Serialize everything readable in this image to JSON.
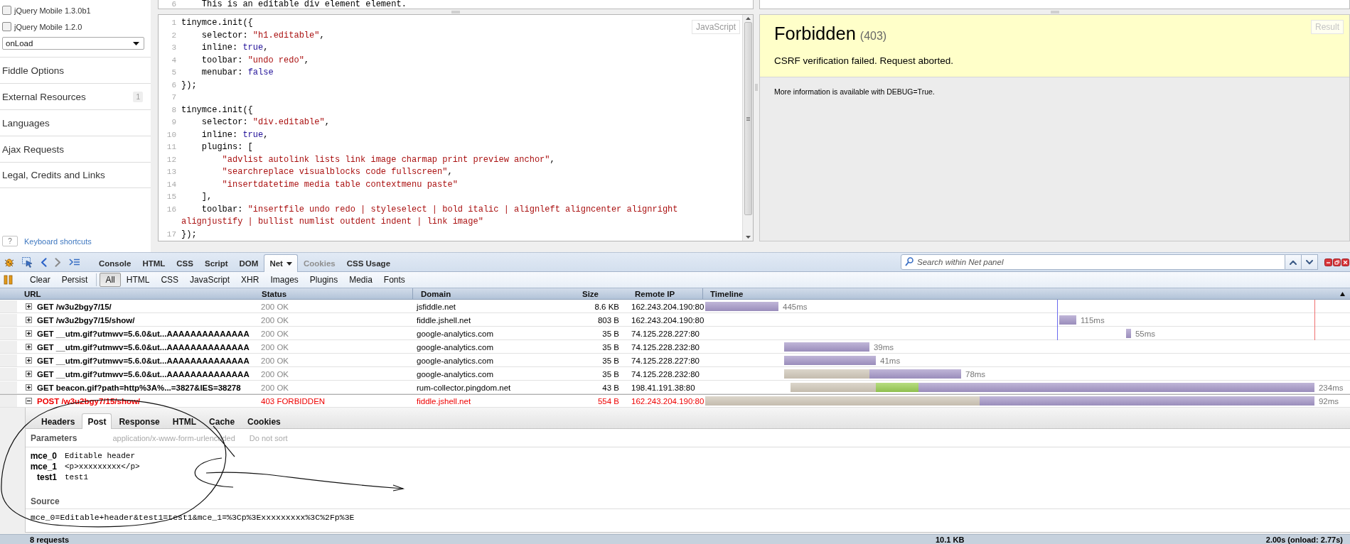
{
  "sidebar": {
    "libraries": [
      {
        "label": "jQuery Mobile 1.3.0b1",
        "checked": false
      },
      {
        "label": "jQuery Mobile 1.2.0",
        "checked": false
      }
    ],
    "load_select": {
      "value": "onLoad"
    },
    "sections": [
      {
        "label": "Fiddle Options"
      },
      {
        "label": "External Resources",
        "badge": "1"
      },
      {
        "label": "Languages"
      },
      {
        "label": "Ajax Requests"
      },
      {
        "label": "Legal, Credits and Links"
      }
    ],
    "shortcuts": {
      "key": "?",
      "link": "Keyboard shortcuts"
    }
  },
  "html_panel": {
    "lines": [
      {
        "number": "6",
        "text": "    This is an editable div element element."
      }
    ]
  },
  "js_panel": {
    "label": "JavaScript",
    "lines": [
      {
        "number": "1",
        "tokens": [
          {
            "kind": "plain",
            "text": "tinymce.init({"
          }
        ]
      },
      {
        "number": "2",
        "tokens": [
          {
            "kind": "plain",
            "text": "    selector: "
          },
          {
            "kind": "string",
            "text": "\"h1.editable\""
          },
          {
            "kind": "plain",
            "text": ","
          }
        ]
      },
      {
        "number": "3",
        "tokens": [
          {
            "kind": "plain",
            "text": "    inline: "
          },
          {
            "kind": "atom",
            "text": "true"
          },
          {
            "kind": "plain",
            "text": ","
          }
        ]
      },
      {
        "number": "4",
        "tokens": [
          {
            "kind": "plain",
            "text": "    toolbar: "
          },
          {
            "kind": "string",
            "text": "\"undo redo\""
          },
          {
            "kind": "plain",
            "text": ","
          }
        ]
      },
      {
        "number": "5",
        "tokens": [
          {
            "kind": "plain",
            "text": "    menubar: "
          },
          {
            "kind": "atom",
            "text": "false"
          }
        ]
      },
      {
        "number": "6",
        "tokens": [
          {
            "kind": "plain",
            "text": "});"
          }
        ]
      },
      {
        "number": "7"
      },
      {
        "number": "8",
        "tokens": [
          {
            "kind": "plain",
            "text": "tinymce.init({"
          }
        ]
      },
      {
        "number": "9",
        "tokens": [
          {
            "kind": "plain",
            "text": "    selector: "
          },
          {
            "kind": "string",
            "text": "\"div.editable\""
          },
          {
            "kind": "plain",
            "text": ","
          }
        ]
      },
      {
        "number": "10",
        "tokens": [
          {
            "kind": "plain",
            "text": "    inline: "
          },
          {
            "kind": "atom",
            "text": "true"
          },
          {
            "kind": "plain",
            "text": ","
          }
        ]
      },
      {
        "number": "11",
        "tokens": [
          {
            "kind": "plain",
            "text": "    plugins: ["
          }
        ]
      },
      {
        "number": "12",
        "tokens": [
          {
            "kind": "string",
            "text": "        \"advlist autolink lists link image charmap print preview anchor\""
          },
          {
            "kind": "plain",
            "text": ","
          }
        ]
      },
      {
        "number": "13",
        "tokens": [
          {
            "kind": "string",
            "text": "        \"searchreplace visualblocks code fullscreen\""
          },
          {
            "kind": "plain",
            "text": ","
          }
        ]
      },
      {
        "number": "14",
        "tokens": [
          {
            "kind": "string",
            "text": "        \"insertdatetime media table contextmenu paste\""
          }
        ]
      },
      {
        "number": "15",
        "tokens": [
          {
            "kind": "plain",
            "text": "    ],"
          }
        ]
      },
      {
        "number": "16",
        "tokens": [
          {
            "kind": "plain",
            "text": "    toolbar: "
          },
          {
            "kind": "string",
            "text": "\"insertfile undo redo | styleselect | bold italic | alignleft aligncenter alignright alignjustify | bullist numlist outdent indent | link image\""
          }
        ]
      },
      {
        "number": "17",
        "tokens": [
          {
            "kind": "plain",
            "text": "});"
          }
        ]
      }
    ]
  },
  "result_panel": {
    "label": "Result",
    "title": "Forbidden",
    "code": "(403)",
    "message": "CSRF verification failed. Request aborted.",
    "info": "More information is available with DEBUG=True."
  },
  "firebug": {
    "panel_tabs": [
      {
        "label": "Console",
        "selected": false,
        "disabled": false,
        "dropdown": false
      },
      {
        "label": "HTML",
        "selected": false,
        "disabled": false,
        "dropdown": false
      },
      {
        "label": "CSS",
        "selected": false,
        "disabled": false,
        "dropdown": false
      },
      {
        "label": "Script",
        "selected": false,
        "disabled": false,
        "dropdown": false
      },
      {
        "label": "DOM",
        "selected": false,
        "disabled": false,
        "dropdown": false
      },
      {
        "label": "Net",
        "selected": true,
        "disabled": false,
        "dropdown": true
      },
      {
        "label": "Cookies",
        "selected": false,
        "disabled": true,
        "dropdown": false
      },
      {
        "label": "CSS Usage",
        "selected": false,
        "disabled": false,
        "dropdown": false
      }
    ],
    "search": {
      "placeholder": "Search within Net panel"
    },
    "actions": [
      "Clear",
      "Persist"
    ],
    "filters": [
      {
        "label": "All",
        "selected": true
      },
      {
        "label": "HTML",
        "selected": false
      },
      {
        "label": "CSS",
        "selected": false
      },
      {
        "label": "JavaScript",
        "selected": false
      },
      {
        "label": "XHR",
        "selected": false
      },
      {
        "label": "Images",
        "selected": false
      },
      {
        "label": "Plugins",
        "selected": false
      },
      {
        "label": "Media",
        "selected": false
      },
      {
        "label": "Fonts",
        "selected": false
      }
    ],
    "net_table": {
      "columns": [
        "URL",
        "Status",
        "Domain",
        "Size",
        "Remote IP",
        "Timeline"
      ],
      "rows": [
        {
          "url": "GET /w3u2bgy7/15/",
          "status": "200 OK",
          "domain": "jsfiddle.net",
          "size": "8.6 KB",
          "remote_ip": "162.243.204.190:80",
          "time": "445ms",
          "expanded": false,
          "error": false
        },
        {
          "url": "GET /w3u2bgy7/15/show/",
          "status": "200 OK",
          "domain": "fiddle.jshell.net",
          "size": "803 B",
          "remote_ip": "162.243.204.190:80",
          "time": "115ms",
          "expanded": false,
          "error": false
        },
        {
          "url": "GET __utm.gif?utmwv=5.6.0&ut...AAAAAAAAAAAAAA",
          "status": "200 OK",
          "domain": "google-analytics.com",
          "size": "35 B",
          "remote_ip": "74.125.228.227:80",
          "time": "55ms",
          "expanded": false,
          "error": false
        },
        {
          "url": "GET __utm.gif?utmwv=5.6.0&ut...AAAAAAAAAAAAAA",
          "status": "200 OK",
          "domain": "google-analytics.com",
          "size": "35 B",
          "remote_ip": "74.125.228.232:80",
          "time": "39ms",
          "expanded": false,
          "error": false
        },
        {
          "url": "GET __utm.gif?utmwv=5.6.0&ut...AAAAAAAAAAAAAA",
          "status": "200 OK",
          "domain": "google-analytics.com",
          "size": "35 B",
          "remote_ip": "74.125.228.227:80",
          "time": "41ms",
          "expanded": false,
          "error": false
        },
        {
          "url": "GET __utm.gif?utmwv=5.6.0&ut...AAAAAAAAAAAAAA",
          "status": "200 OK",
          "domain": "google-analytics.com",
          "size": "35 B",
          "remote_ip": "74.125.228.232:80",
          "time": "78ms",
          "expanded": false,
          "error": false
        },
        {
          "url": "GET beacon.gif?path=http%3A%...=3827&lES=38278",
          "status": "200 OK",
          "domain": "rum-collector.pingdom.net",
          "size": "43 B",
          "remote_ip": "198.41.191.38:80",
          "time": "234ms",
          "expanded": false,
          "error": false
        },
        {
          "url": "POST /w3u2bgy7/15/show/",
          "status": "403 FORBIDDEN",
          "domain": "fiddle.jshell.net",
          "size": "554 B",
          "remote_ip": "162.243.204.190:80",
          "time": "92ms",
          "expanded": true,
          "error": true
        }
      ]
    },
    "details": {
      "tabs": [
        {
          "label": "Headers",
          "selected": false
        },
        {
          "label": "Post",
          "selected": true
        },
        {
          "label": "Response",
          "selected": false
        },
        {
          "label": "HTML",
          "selected": false
        },
        {
          "label": "Cache",
          "selected": false
        },
        {
          "label": "Cookies",
          "selected": false
        }
      ],
      "parameters": {
        "title": "Parameters",
        "content_type": "application/x-www-form-urlencoded",
        "sort_link": "Do not sort",
        "items": [
          {
            "name": "mce_0",
            "value": "Editable header"
          },
          {
            "name": "mce_1",
            "value": "<p>xxxxxxxxx</p>"
          },
          {
            "name": "test1",
            "value": "test1"
          }
        ]
      },
      "source": {
        "title": "Source",
        "text": "mce_0=Editable+header&test1=test1&mce_1=%3Cp%3Exxxxxxxxx%3C%2Fp%3E"
      }
    },
    "status_bar": {
      "requests": "8 requests",
      "size": "10.1 KB",
      "timing": "2.00s (onload: 2.77s)"
    }
  }
}
